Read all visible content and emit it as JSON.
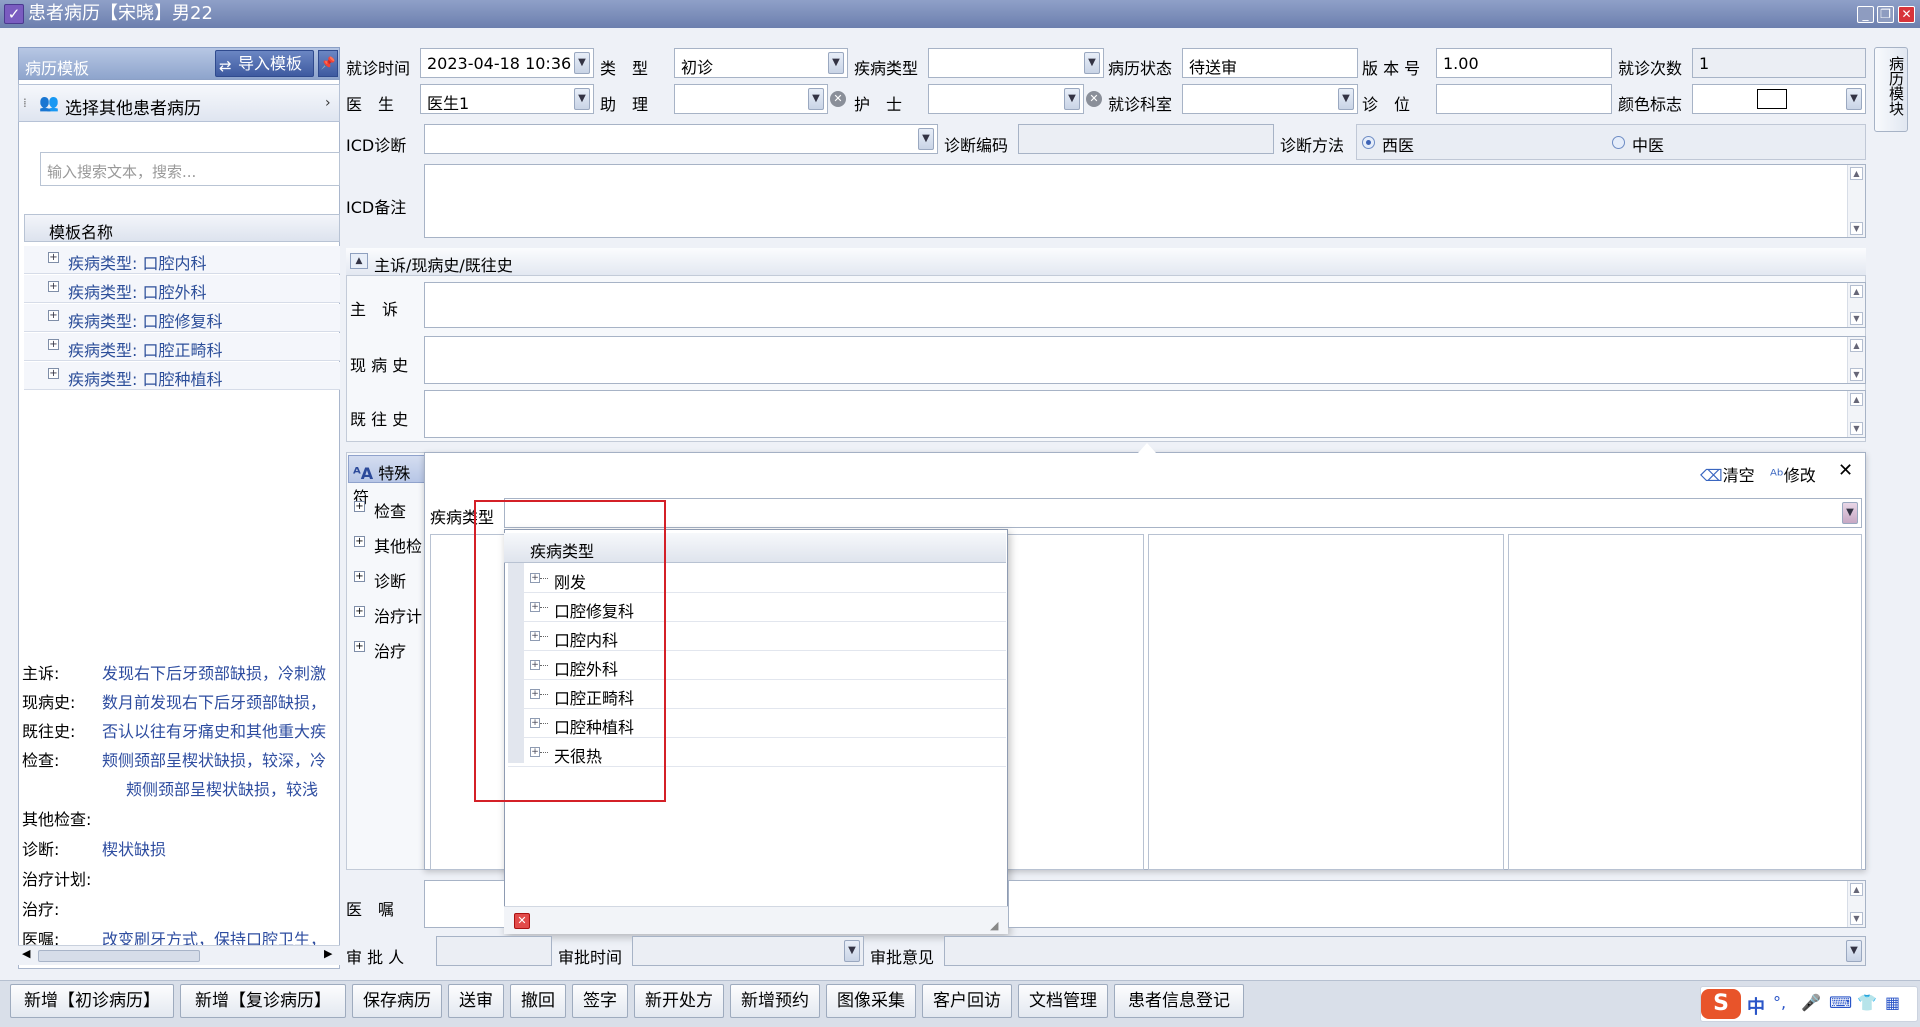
{
  "window": {
    "title": "患者病历【宋晓】男22"
  },
  "left_panel": {
    "title": "病历模板",
    "import_button": "导入模板",
    "select_other": "选择其他患者病历",
    "search_placeholder": "输入搜索文本，搜索...",
    "column": "模板名称",
    "templates": [
      "疾病类型: 口腔内科",
      "疾病类型: 口腔外科",
      "疾病类型: 口腔修复科",
      "疾病类型: 口腔正畸科",
      "疾病类型: 口腔种植科"
    ],
    "summary": [
      {
        "k": "主诉:",
        "v": "发现右下后牙颈部缺损，冷刺激"
      },
      {
        "k": "现病史:",
        "v": "数月前发现右下后牙颈部缺损，"
      },
      {
        "k": "既往史:",
        "v": "否认以往有牙痛史和其他重大疾"
      },
      {
        "k": "检查:",
        "v": "颊侧颈部呈楔状缺损，较深，冷"
      },
      {
        "k": "",
        "v": "颊侧颈部呈楔状缺损，较浅"
      },
      {
        "k": "其他检查:",
        "v": ""
      },
      {
        "k": "诊断:",
        "v": "楔状缺损"
      },
      {
        "k": "治疗计划:",
        "v": ""
      },
      {
        "k": "治疗:",
        "v": ""
      },
      {
        "k": "医嘱:",
        "v": "改变刷牙方式，保持口腔卫生，"
      }
    ]
  },
  "form": {
    "visit_time_label": "就诊时间",
    "visit_time": "2023-04-18 10:36",
    "type_label": "类　型",
    "type": "初诊",
    "disease_type_label": "疾病类型",
    "disease_type": "",
    "status_label": "病历状态",
    "status": "待送审",
    "version_label": "版 本 号",
    "version": "1.00",
    "visit_count_label": "就诊次数",
    "visit_count": "1",
    "doctor_label": "医　生",
    "doctor": "医生1",
    "assistant_label": "助　理",
    "assistant": "",
    "nurse_label": "护　士",
    "nurse": "",
    "dept_label": "就诊科室",
    "dept": "",
    "seat_label": "诊　位",
    "seat": "",
    "color_label": "颜色标志",
    "icd_label": "ICD诊断",
    "icd": "",
    "code_label": "诊断编码",
    "code": "",
    "method_label": "诊断方法",
    "method_options": [
      "西医",
      "中医"
    ],
    "icd_note_label": "ICD备注"
  },
  "history": {
    "header": "主诉/现病史/既往史",
    "chief_label": "主　诉",
    "present_label": "现 病 史",
    "past_label": "既 往 史"
  },
  "special": {
    "tab": "特殊符",
    "clear": "清空",
    "modify": "修改",
    "categories": [
      "检查",
      "其他检",
      "诊断",
      "治疗计",
      "治疗"
    ],
    "disease_type_label": "疾病类型"
  },
  "tree": {
    "header": "疾病类型",
    "items": [
      "刚发",
      "口腔修复科",
      "口腔内科",
      "口腔外科",
      "口腔正畸科",
      "口腔种植科",
      "天很热"
    ]
  },
  "bottom": {
    "advice_label": "医　嘱",
    "approver_label": "审 批 人",
    "approve_time_label": "审批时间",
    "approve_opinion_label": "审批意见"
  },
  "side_tab": "病历模块",
  "toolbar": [
    "新增【初诊病历】",
    "新增【复诊病历】",
    "保存病历",
    "送审",
    "撤回",
    "签字",
    "新开处方",
    "新增预约",
    "图像采集",
    "客户回访",
    "文档管理",
    "患者信息登记"
  ],
  "ime": {
    "lang": "中"
  }
}
